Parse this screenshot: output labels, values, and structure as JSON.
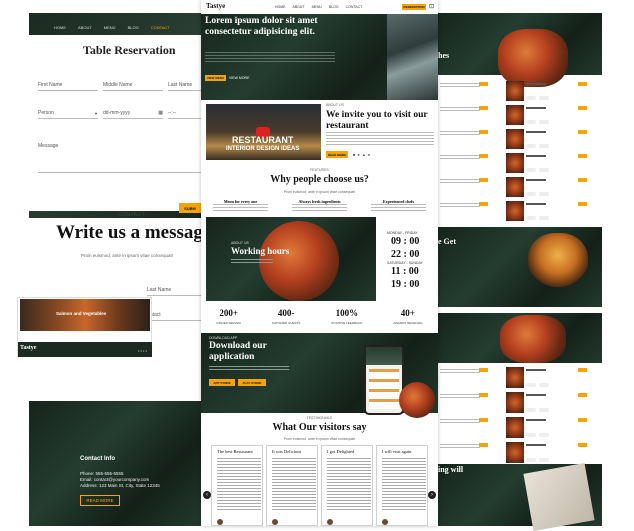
{
  "reservation": {
    "nav": [
      "HOME",
      "ABOUT",
      "MENU",
      "BLOG",
      "CONTACT"
    ],
    "title": "Table Reservation",
    "first_name": "First Name",
    "middle_name": "Middle Name",
    "last_name": "Last Name",
    "person": "Person",
    "date": "dd-mm-yyyy",
    "time": "--:--",
    "message": "Message",
    "submit": "SUBM"
  },
  "contact": {
    "eyebrow": "CONTACT",
    "title": "Write us a message",
    "subtitle": "Proin euismod, ante in ipsum vitae consequat!",
    "last_name": "Last Name",
    "contact": "ontact",
    "caption": "Salmon and Vegetables",
    "logo": "Tastye",
    "info_title": "Contact Info",
    "phone": "Phone: 555-555-5555",
    "email": "Email: contact@yourcompany.com",
    "address": "Address: 123 Main St, City, State 12345",
    "read_more": "READ MORE"
  },
  "hero": {
    "logo": "Tastye",
    "nav": [
      "HOME",
      "ABOUT",
      "MENU",
      "BLOG",
      "CONTACT"
    ],
    "reserve": "RESERVATION",
    "heading": "Lorem ipsum dolor sit amet consectetur adipisicing elit.",
    "btn1": "VIEW MENU",
    "btn2": "VIEW MORE"
  },
  "invite": {
    "video_title": "RESTAURANT",
    "video_sub": "INTERIOR DESIGN IDEAS",
    "eyebrow": "ABOUT US",
    "title": "We invite you to visit our restaurant",
    "btn": "READ MORE"
  },
  "why": {
    "eyebrow": "FEATURES",
    "title": "Why people choose us?",
    "subtitle": "Proin euismod, ante in ipsum vitae consequat!",
    "features": [
      "Menu for every one",
      "Always fresh ingredients",
      "Experienced chefs"
    ]
  },
  "hours": {
    "eyebrow": "ABOUT US",
    "title": "Working hours",
    "morning_label": "MONDAY - FRIDAY",
    "times": [
      "09 : 00",
      "22 : 00",
      "11 : 00",
      "19 : 00"
    ],
    "weekend_label": "SATURDAY - SUNDAY"
  },
  "stats": [
    {
      "value": "200+",
      "label": "DISHES SERVED"
    },
    {
      "value": "400-",
      "label": "SATISFIED GUESTS"
    },
    {
      "value": "100%",
      "label": "POSITIVE FEEDBACK"
    },
    {
      "value": "40+",
      "label": "AWARDS RECEIVED"
    }
  ],
  "app": {
    "eyebrow": "DOWNLOAD APP",
    "title": "Download our application",
    "btn1": "APP STORE",
    "btn2": "PLAY STORE"
  },
  "testimonials": {
    "eyebrow": "TESTIMONIALS",
    "title": "What Our visitors say",
    "subtitle": "Proin euismod, ante in ipsum vitae consequat!",
    "cards": [
      "The best Restaurant",
      "It was Delicious",
      "I got Delighted",
      "I will visit again"
    ]
  },
  "right": {
    "title1": "hes",
    "title2": "e Get",
    "title3": "ing will"
  }
}
